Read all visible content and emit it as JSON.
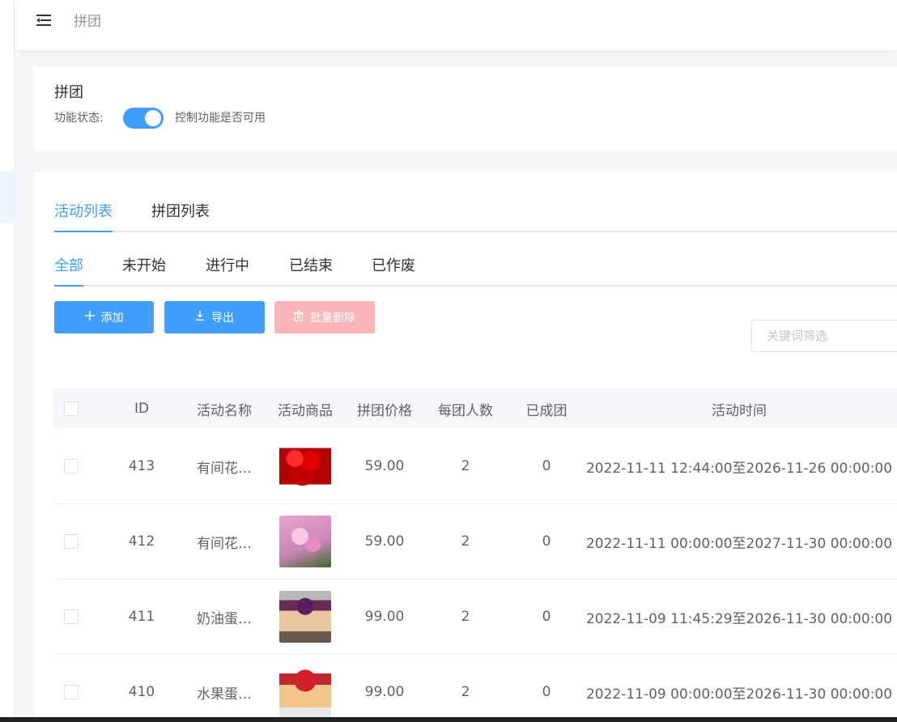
{
  "header": {
    "title": "拼团"
  },
  "status_card": {
    "title": "拼团",
    "status_label": "功能状态:",
    "switch_on": true,
    "status_hint": "控制功能是否可用"
  },
  "tabs_primary": [
    "活动列表",
    "拼团列表"
  ],
  "tabs_secondary": [
    "全部",
    "未开始",
    "进行中",
    "已结束",
    "已作废"
  ],
  "buttons": {
    "add": "添加",
    "export": "导出",
    "batch_delete": "批量删除"
  },
  "search": {
    "placeholder": "关键词筛选"
  },
  "table": {
    "headers": [
      "ID",
      "活动名称",
      "活动商品",
      "拼团价格",
      "每团人数",
      "已成团",
      "活动时间"
    ],
    "rows": [
      {
        "id": "413",
        "name": "有间花…",
        "image": "red-roses",
        "price": "59.00",
        "group_size": "2",
        "completed": "0",
        "time": "2022-11-11 12:44:00至2026-11-26 00:00:00"
      },
      {
        "id": "412",
        "name": "有间花…",
        "image": "pink-lily",
        "price": "59.00",
        "group_size": "2",
        "completed": "0",
        "time": "2022-11-11 00:00:00至2027-11-30 00:00:00"
      },
      {
        "id": "411",
        "name": "奶油蛋…",
        "image": "cream-cake",
        "price": "99.00",
        "group_size": "2",
        "completed": "0",
        "time": "2022-11-09 11:45:29至2026-11-30 00:00:00"
      },
      {
        "id": "410",
        "name": "水果蛋…",
        "image": "fruit-cake",
        "price": "99.00",
        "group_size": "2",
        "completed": "0",
        "time": "2022-11-09 00:00:00至2026-11-30 00:00:00"
      }
    ]
  },
  "colors": {
    "primary": "#409eff",
    "danger_disabled": "#fab6b6"
  }
}
